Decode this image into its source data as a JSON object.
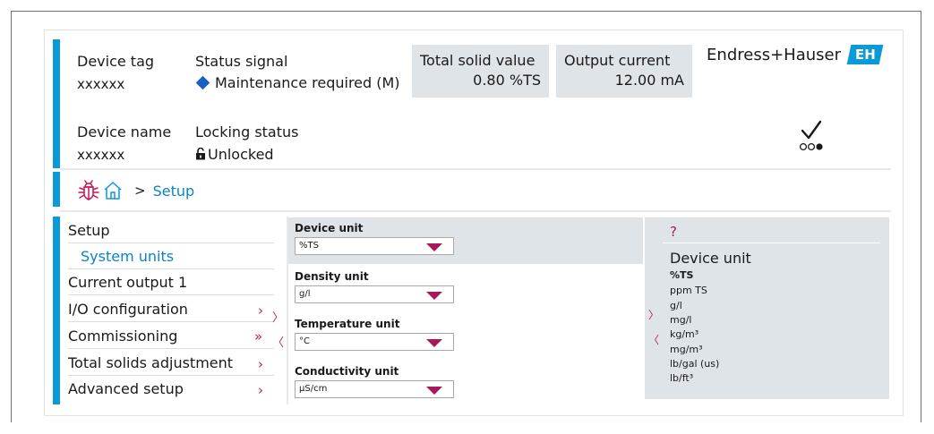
{
  "header": {
    "device_tag_label": "Device tag",
    "device_tag_value": "xxxxxx",
    "status_signal_label": "Status signal",
    "status_signal_value": "Maintenance required (M)",
    "total_solid_label": "Total solid value",
    "total_solid_value": "0.80 %TS",
    "output_current_label": "Output current",
    "output_current_value": "12.00 mA",
    "brand": "Endress+Hauser",
    "brand_mark": "EH",
    "device_name_label": "Device name",
    "device_name_value": "xxxxxx",
    "locking_status_label": "Locking status",
    "locking_status_value": "Unlocked"
  },
  "breadcrumb": {
    "separator": ">",
    "current": "Setup"
  },
  "menu": {
    "items": [
      {
        "label": "Setup"
      },
      {
        "label": "System units"
      },
      {
        "label": "Current output 1"
      },
      {
        "label": "I/O configuration"
      },
      {
        "label": "Commissioning"
      },
      {
        "label": "Total solids adjustment"
      },
      {
        "label": "Advanced setup"
      }
    ]
  },
  "fields": [
    {
      "label": "Device unit",
      "value": "%TS"
    },
    {
      "label": "Density unit",
      "value": "g/l"
    },
    {
      "label": "Temperature unit",
      "value": "°C"
    },
    {
      "label": "Conductivity unit",
      "value": "µS/cm"
    }
  ],
  "help": {
    "question_mark": "?",
    "title": "Device unit",
    "options": [
      "%TS",
      "ppm TS",
      "g/l",
      "mg/l",
      "kg/m³",
      "mg/m³",
      "lb/gal (us)",
      "lb/ft³"
    ]
  },
  "glyphs": {
    "chevron_right": "›",
    "chevron_double": "»",
    "panel_right": "〉",
    "panel_left": "〈"
  },
  "colors": {
    "accent_blue": "#0a9ad8",
    "accent_magenta": "#a6185a",
    "value_box_bg": "#dfe4e9"
  }
}
